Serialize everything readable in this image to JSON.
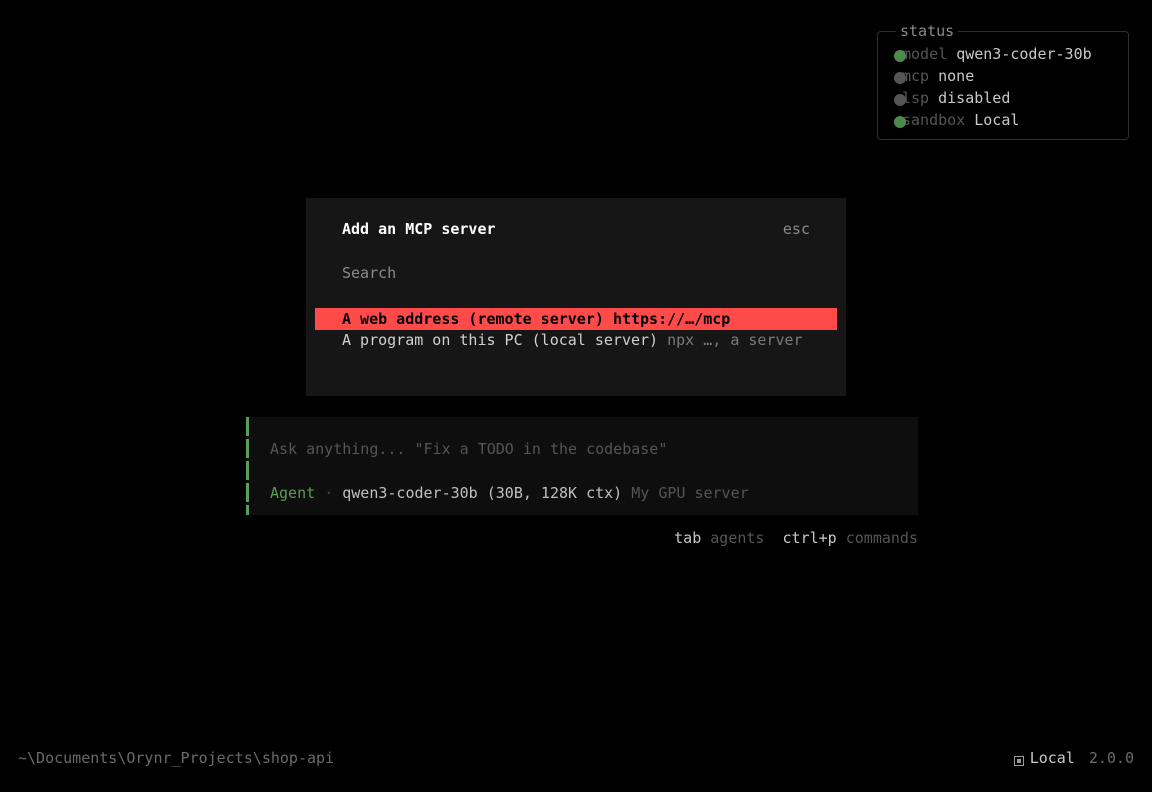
{
  "status": {
    "title": "status",
    "items": [
      {
        "key": "model",
        "value": "qwen3-coder-30b",
        "color": "#4d8a4d"
      },
      {
        "key": "mcp",
        "value": "none",
        "color": "#555555"
      },
      {
        "key": "lsp",
        "value": "disabled",
        "color": "#555555"
      },
      {
        "key": "sandbox",
        "value": "Local",
        "color": "#4d8a4d"
      }
    ]
  },
  "modal": {
    "title": "Add an MCP server",
    "close_hint": "esc",
    "search_placeholder": "Search",
    "options": [
      {
        "label": "A web address (remote server)",
        "hint": "https://…/mcp"
      },
      {
        "label": "A program on this PC (local server)",
        "hint": "npx …, a server"
      }
    ]
  },
  "prompt": {
    "placeholder": "Ask anything... \"Fix a TODO in the codebase\"",
    "agent": "Agent",
    "separator": "·",
    "model": "qwen3-coder-30b (30B, 128K ctx)",
    "provider": "My GPU server"
  },
  "key_hints": [
    {
      "key": "tab",
      "desc": "agents"
    },
    {
      "key": "ctrl+p",
      "desc": "commands"
    }
  ],
  "footer": {
    "path": "~\\Documents\\Orynr_Projects\\shop-api",
    "mode": "Local",
    "version": "2.0.0"
  },
  "colors": {
    "accent_red": "#ff4a4a",
    "agent_green": "#5b9b5b",
    "background": "#000000"
  }
}
